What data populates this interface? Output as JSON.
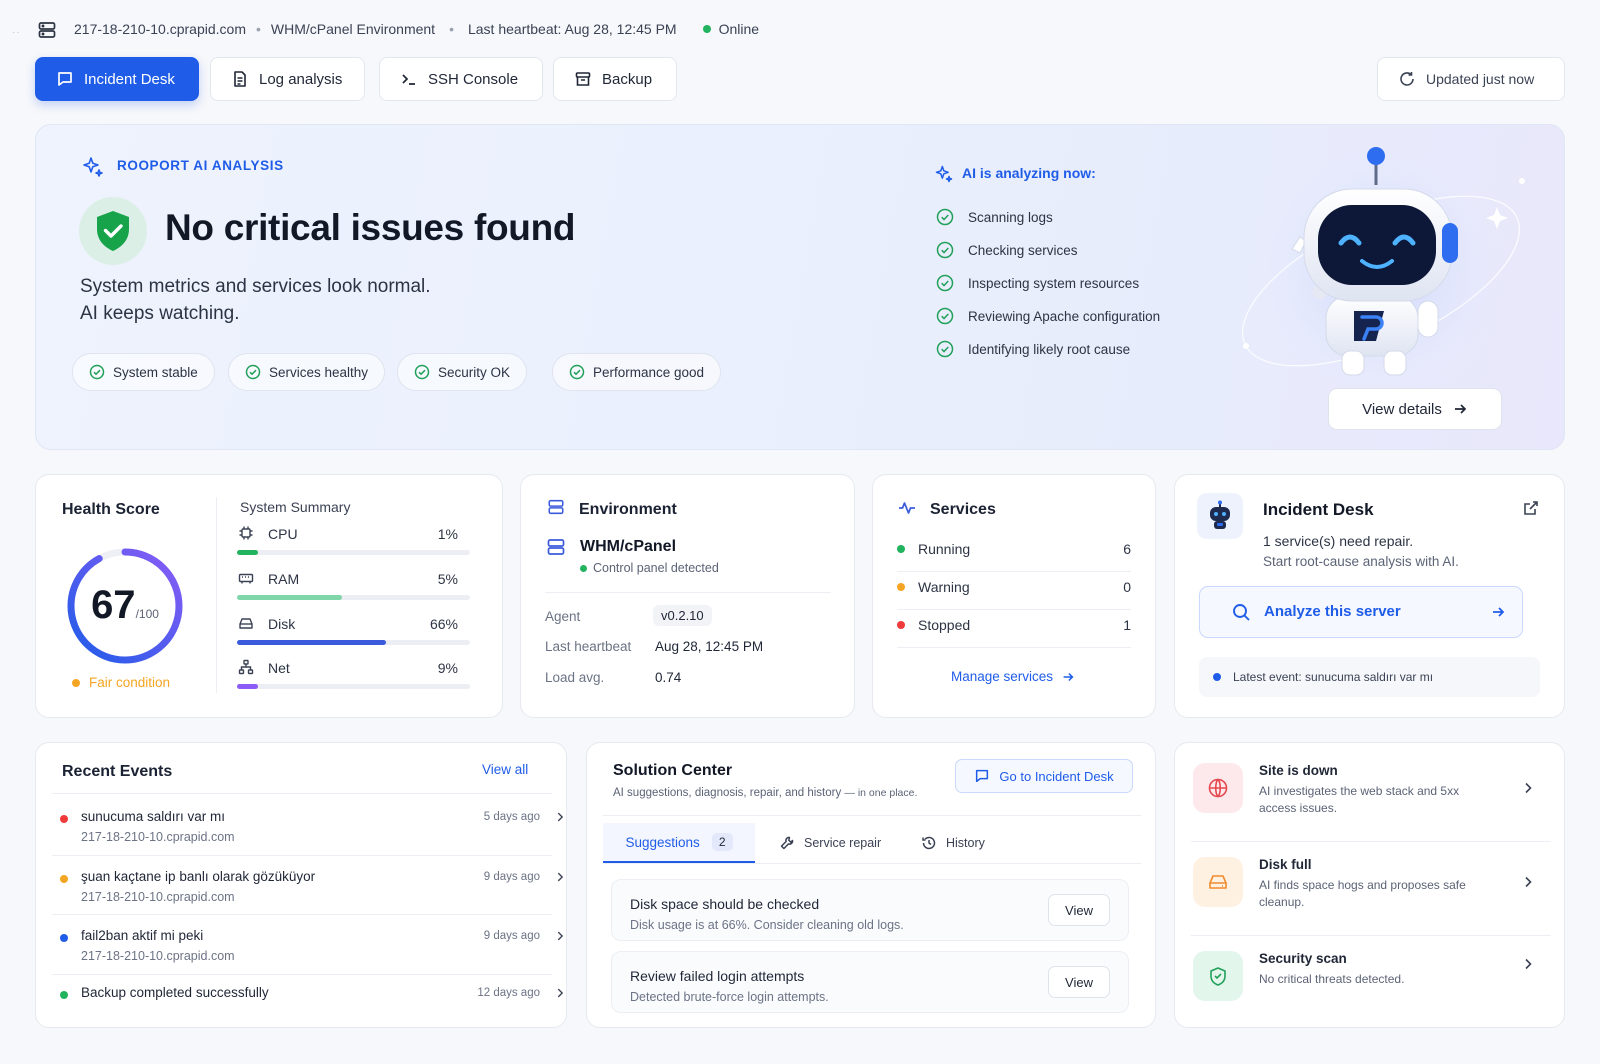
{
  "topbar": {
    "host": "217-18-210-10.cprapid.com",
    "environment": "WHM/cPanel Environment",
    "heartbeat": "Last heartbeat: Aug 28, 12:45 PM",
    "status": "Online",
    "status_color": "#22b35e"
  },
  "tabs": [
    {
      "label": "Incident Desk",
      "icon": "message-square-icon",
      "active": true
    },
    {
      "label": "Log analysis",
      "icon": "file-text-icon"
    },
    {
      "label": "SSH Console",
      "icon": "terminal-icon"
    },
    {
      "label": "Backup",
      "icon": "archive-icon"
    }
  ],
  "updated_label": "Updated just now",
  "hero": {
    "eyebrow": "ROOPORT AI ANALYSIS",
    "title": "No critical issues found",
    "subtitle_line1": "System metrics and services look normal.",
    "subtitle_line2": "AI keeps watching.",
    "pills": [
      "System stable",
      "Services healthy",
      "Security OK",
      "Performance good"
    ],
    "analyzing_title": "AI is analyzing now:",
    "steps": [
      "Scanning logs",
      "Checking services",
      "Inspecting system resources",
      "Reviewing Apache configuration",
      "Identifying likely root cause"
    ],
    "view_details": "View details",
    "accent": "#1f5ce8"
  },
  "health": {
    "title": "Health Score",
    "score": "67",
    "score_max": "/100",
    "score_fraction": 0.67,
    "condition": "Fair condition",
    "condition_color": "#f5a524",
    "summary_title": "System Summary",
    "metrics": [
      {
        "name": "CPU",
        "value": "1%",
        "fraction": 0.09,
        "color": "#22b35e",
        "icon": "cpu-icon"
      },
      {
        "name": "RAM",
        "value": "5%",
        "fraction": 0.45,
        "color": "#7fd6a8",
        "icon": "memory-icon"
      },
      {
        "name": "Disk",
        "value": "66%",
        "fraction": 0.64,
        "color": "#3b5bdb",
        "icon": "hard-drive-icon"
      },
      {
        "name": "Net",
        "value": "9%",
        "fraction": 0.09,
        "color": "#8b5cf6",
        "icon": "network-icon"
      }
    ]
  },
  "environment": {
    "title": "Environment",
    "name": "WHM/cPanel",
    "detected": "Control panel detected",
    "agent_label": "Agent",
    "agent_value": "v0.2.10",
    "heartbeat_label": "Last heartbeat",
    "heartbeat_value": "Aug 28, 12:45 PM",
    "load_label": "Load avg.",
    "load_value": "0.74"
  },
  "services": {
    "title": "Services",
    "rows": [
      {
        "label": "Running",
        "value": "6",
        "color": "#22b35e"
      },
      {
        "label": "Warning",
        "value": "0",
        "color": "#f5a524"
      },
      {
        "label": "Stopped",
        "value": "1",
        "color": "#ef3b3b"
      }
    ],
    "manage_label": "Manage services"
  },
  "incident": {
    "title": "Incident Desk",
    "line1": "1 service(s) need repair.",
    "line2": "Start root-cause analysis with AI.",
    "analyze_label": "Analyze this server",
    "latest_event": "Latest event: sunucuma saldırı var mı"
  },
  "events": {
    "title": "Recent Events",
    "view_all": "View all",
    "items": [
      {
        "title": "sunucuma saldırı var mı",
        "host": "217-18-210-10.cprapid.com",
        "ago": "5 days ago",
        "color": "#ef3b3b"
      },
      {
        "title": "şuan kaçtane ip banlı olarak gözüküyor",
        "host": "217-18-210-10.cprapid.com",
        "ago": "9 days ago",
        "color": "#f5a524"
      },
      {
        "title": "fail2ban aktif mi peki",
        "host": "217-18-210-10.cprapid.com",
        "ago": "9 days ago",
        "color": "#1f5ce8"
      },
      {
        "title": "Backup completed successfully",
        "host": "",
        "ago": "12 days ago",
        "color": "#22b35e"
      }
    ]
  },
  "solution": {
    "title": "Solution Center",
    "subtitle": "AI suggestions, diagnosis, repair, and history",
    "subtitle_suffix": "— in one place.",
    "goto_label": "Go to Incident Desk",
    "tabs": [
      {
        "label": "Suggestions",
        "badge": "2"
      },
      {
        "label": "Service repair"
      },
      {
        "label": "History"
      }
    ],
    "items": [
      {
        "title": "Disk space should be checked",
        "desc": "Disk usage is at 66%. Consider cleaning old logs.",
        "btn": "View"
      },
      {
        "title": "Review failed login attempts",
        "desc": "Detected brute-force login attempts.",
        "btn": "View"
      }
    ]
  },
  "quick_actions": [
    {
      "title": "Site is down",
      "desc": "AI investigates the web stack and 5xx access issues.",
      "icon": "globe-icon",
      "bg": "#fde8ec",
      "color": "#e5484d"
    },
    {
      "title": "Disk full",
      "desc": "AI finds space hogs and proposes safe cleanup.",
      "icon": "hard-drive-icon",
      "bg": "#fff1e2",
      "color": "#f08c2e"
    },
    {
      "title": "Security scan",
      "desc": "No critical threats detected.",
      "icon": "shield-scan-icon",
      "bg": "#e3f6ec",
      "color": "#22a05a"
    }
  ]
}
